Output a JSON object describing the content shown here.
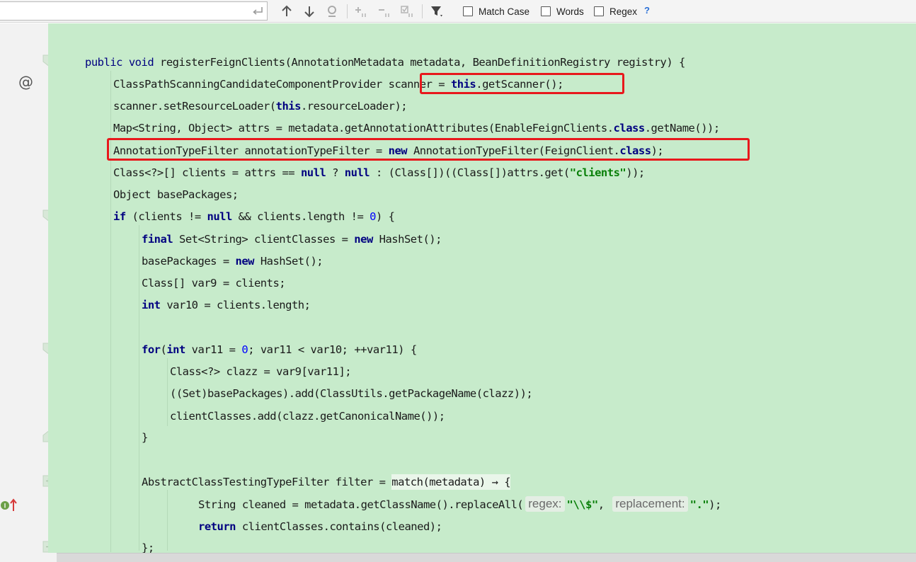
{
  "toolbar": {
    "search_value": "",
    "options": [
      {
        "label": "Match Case",
        "checked": false
      },
      {
        "label": "Words",
        "checked": false
      },
      {
        "label": "Regex",
        "checked": false
      }
    ],
    "help": "?",
    "icons": [
      "enter-icon",
      "arrow-up-icon",
      "arrow-down-icon",
      "find-occurrences-icon",
      "add-selection-icon",
      "remove-selection-icon",
      "select-all-occurrences-icon",
      "filter-icon"
    ]
  },
  "gutter": {
    "override_marker": "@",
    "implements_marker": "I"
  },
  "code": {
    "lines": [
      {
        "tokens": [
          [
            "public",
            "kw-plain"
          ],
          [
            " ",
            ""
          ],
          [
            "void",
            "kw-plain"
          ],
          [
            " registerFeignClients(AnnotationMetadata metadata, BeanDefinitionRegistry registry) {",
            ""
          ]
        ]
      },
      {
        "tokens": [
          [
            "ClassPathScanningCandidateComponentProvider ",
            ""
          ],
          [
            "scanner = ",
            ""
          ],
          [
            "this",
            "kw"
          ],
          [
            ".getScanner();",
            ""
          ]
        ]
      },
      {
        "tokens": [
          [
            "scanner.setResourceLoader(",
            ""
          ],
          [
            "this",
            "kw"
          ],
          [
            ".resourceLoader);",
            ""
          ]
        ]
      },
      {
        "tokens": [
          [
            "Map<String, Object> attrs = metadata.getAnnotationAttributes(EnableFeignClients.",
            ""
          ],
          [
            "class",
            "kw"
          ],
          [
            ".getName());",
            ""
          ]
        ]
      },
      {
        "tokens": [
          [
            "AnnotationTypeFilter annotationTypeFilter = ",
            ""
          ],
          [
            "new",
            "kw"
          ],
          [
            " AnnotationTypeFilter(FeignClient.",
            ""
          ],
          [
            "class",
            "kw"
          ],
          [
            ");",
            ""
          ]
        ]
      },
      {
        "tokens": [
          [
            "Class<?>[] clients = attrs == ",
            ""
          ],
          [
            "null",
            "kw"
          ],
          [
            " ? ",
            ""
          ],
          [
            "null",
            "kw"
          ],
          [
            " : (Class[])((Class[])attrs.get(",
            ""
          ],
          [
            "\"clients\"",
            "str"
          ],
          [
            "));",
            ""
          ]
        ]
      },
      {
        "tokens": [
          [
            "Object basePackages;",
            ""
          ]
        ]
      },
      {
        "tokens": [
          [
            "if",
            "kw"
          ],
          [
            " (clients != ",
            ""
          ],
          [
            "null",
            "kw"
          ],
          [
            " && clients.length != ",
            ""
          ],
          [
            "0",
            "num"
          ],
          [
            ") {",
            ""
          ]
        ]
      },
      {
        "tokens": [
          [
            "final",
            "kw"
          ],
          [
            " Set<String> clientClasses = ",
            ""
          ],
          [
            "new",
            "kw"
          ],
          [
            " HashSet();",
            ""
          ]
        ]
      },
      {
        "tokens": [
          [
            "basePackages = ",
            ""
          ],
          [
            "new",
            "kw"
          ],
          [
            " HashSet();",
            ""
          ]
        ]
      },
      {
        "tokens": [
          [
            "Class[] var9 = clients;",
            ""
          ]
        ]
      },
      {
        "tokens": [
          [
            "int",
            "kw"
          ],
          [
            " var10 = clients.length;",
            ""
          ]
        ]
      },
      {
        "tokens": []
      },
      {
        "tokens": [
          [
            "for",
            "kw"
          ],
          [
            "(",
            ""
          ],
          [
            "int",
            "kw"
          ],
          [
            " var11 = ",
            ""
          ],
          [
            "0",
            "num"
          ],
          [
            "; var11 < var10; ++var11) {",
            ""
          ]
        ]
      },
      {
        "tokens": [
          [
            "Class<?> clazz = var9[var11];",
            ""
          ]
        ]
      },
      {
        "tokens": [
          [
            "((Set)basePackages).add(ClassUtils.getPackageName(clazz));",
            ""
          ]
        ]
      },
      {
        "tokens": [
          [
            "clientClasses.add(clazz.getCanonicalName());",
            ""
          ]
        ]
      },
      {
        "tokens": [
          [
            "}",
            ""
          ]
        ]
      },
      {
        "tokens": []
      },
      {
        "tokens": [
          [
            "AbstractClassTestingTypeFilter filter = ",
            ""
          ],
          [
            "match(metadata) → {",
            "lambda"
          ]
        ]
      },
      {
        "tokens": [
          [
            "String cleaned = metadata.getClassName().replaceAll(",
            ""
          ],
          [
            "regex:",
            "hint"
          ],
          [
            "\"\\\\$\"",
            "str"
          ],
          [
            ", ",
            ""
          ],
          [
            "replacement:",
            "hint"
          ],
          [
            "\".\"",
            "str"
          ],
          [
            ");",
            ""
          ]
        ]
      },
      {
        "tokens": [
          [
            "return",
            "kw"
          ],
          [
            " clientClasses.contains(cleaned);",
            ""
          ]
        ]
      },
      {
        "tokens": [
          [
            "};",
            ""
          ]
        ]
      }
    ]
  }
}
